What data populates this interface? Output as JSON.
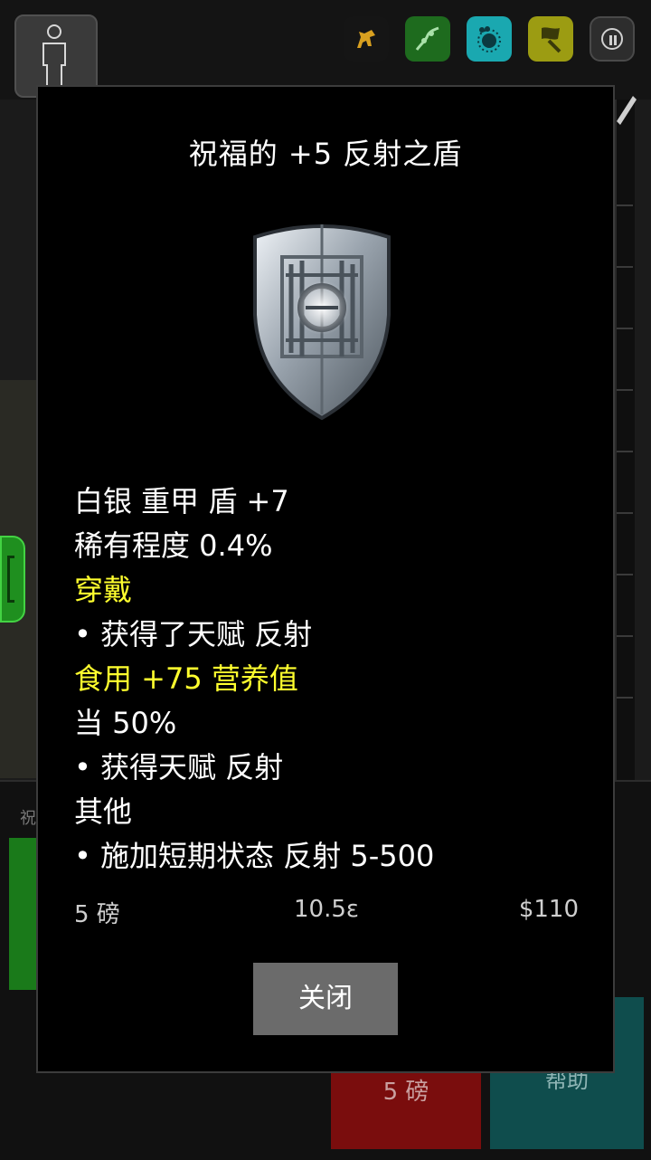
{
  "background": {
    "bottom_left_label": "祝",
    "red_card_label": "5 磅",
    "teal_card_label": "帮助"
  },
  "top_bar": {
    "icons": [
      "character-icon",
      "horse-icon",
      "vine-icon",
      "spore-icon",
      "flag-icon",
      "pause-icon"
    ],
    "icon_colors": {
      "horse": "#151515",
      "vine": "#1e6b1e",
      "spore": "#1aa8b0",
      "flag": "#9c9c12",
      "pause": "#2d2d2d"
    }
  },
  "item": {
    "title": "祝福的 +5 反射之盾",
    "image_icon": "shield-icon",
    "stats": [
      {
        "text": "白银 重甲 盾 +7",
        "highlight": false
      },
      {
        "text": "稀有程度 0.4%",
        "highlight": false
      },
      {
        "text": "穿戴",
        "highlight": true
      },
      {
        "text": "• 获得了天赋 反射",
        "highlight": false
      },
      {
        "text": "食用 +75 营养值",
        "highlight": true
      },
      {
        "text": "当 50%",
        "highlight": false
      },
      {
        "text": "• 获得天赋 反射",
        "highlight": false
      },
      {
        "text": "其他",
        "highlight": false
      },
      {
        "text": "• 施加短期状态 反射 5-500",
        "highlight": false
      }
    ],
    "weight": "5 磅",
    "charge": "10.5ε",
    "price": "$110"
  },
  "dialog": {
    "close_label": "关闭"
  },
  "colors": {
    "highlight": "#ffff2e",
    "dialog_bg": "#000000",
    "close_button_bg": "#6b6b6b"
  }
}
